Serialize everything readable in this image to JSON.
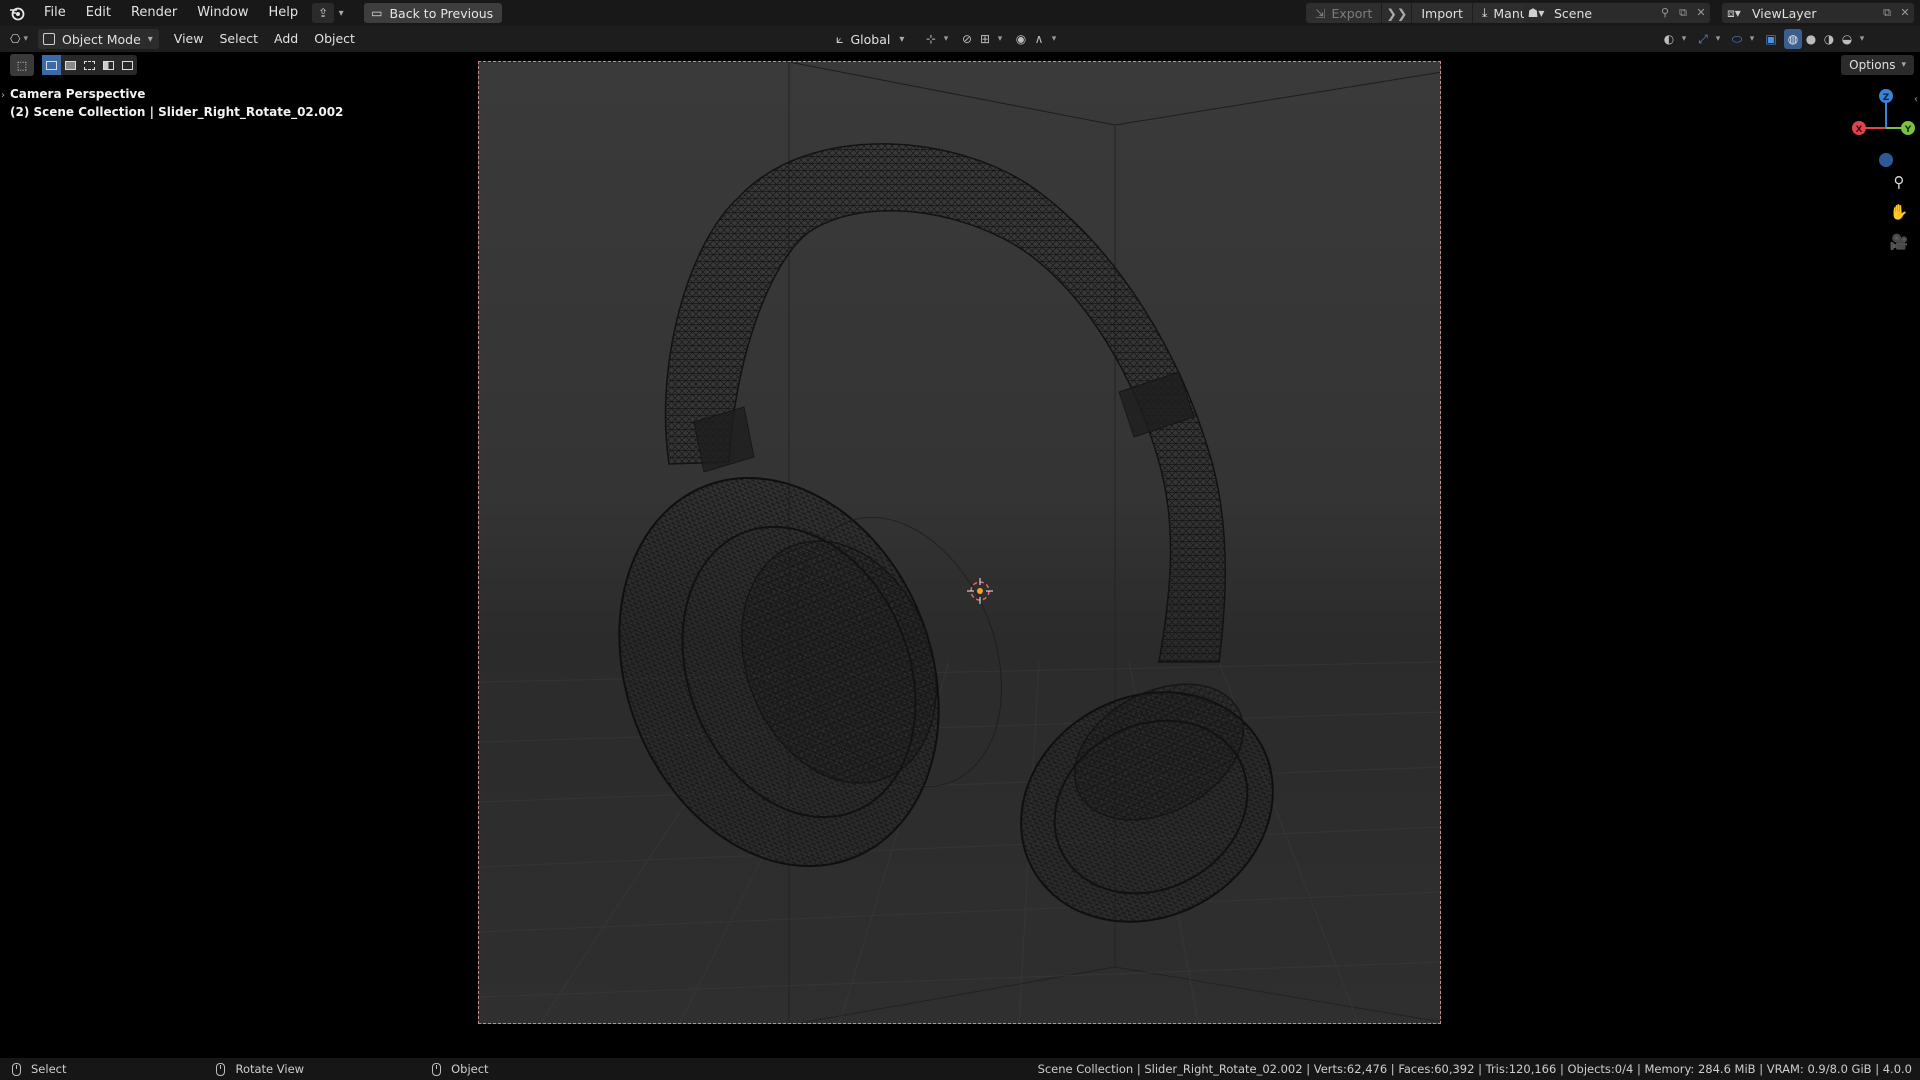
{
  "topbar": {
    "menus": [
      "File",
      "Edit",
      "Render",
      "Window",
      "Help"
    ],
    "back_button": "Back to Previous",
    "export_label": "Export",
    "import_label": "Import",
    "manual_label": "Manual",
    "scene_name": "Scene",
    "view_layer": "ViewLayer"
  },
  "header": {
    "mode": "Object Mode",
    "menus": [
      "View",
      "Select",
      "Add",
      "Object"
    ],
    "transform_orientation": "Global",
    "options_label": "Options"
  },
  "viewport": {
    "perspective_label": "Camera Perspective",
    "collection_label": "(2) Scene Collection | Slider_Right_Rotate_02.002",
    "gizmo": {
      "x": "X",
      "y": "Y",
      "z": "Z"
    }
  },
  "statusbar": {
    "select": "Select",
    "rotate_view": "Rotate View",
    "object": "Object",
    "stats": "Scene Collection | Slider_Right_Rotate_02.002 | Verts:62,476 | Faces:60,392 | Tris:120,166 | Objects:0/4 | Memory: 284.6 MiB | VRAM: 0.9/8.0 GiB | 4.0.0"
  },
  "colors": {
    "axis_x": "#e0444e",
    "axis_y": "#7cc242",
    "axis_z": "#3b82d9",
    "selection_accent": "#3c6aa6",
    "camera_frame_border": "#c98a8a",
    "origin_marker": "#f2a324"
  },
  "icons": {
    "logo": "blender-logo-icon",
    "zoom": "zoom-icon",
    "pan": "hand-pan-icon",
    "camera": "camera-view-icon"
  }
}
